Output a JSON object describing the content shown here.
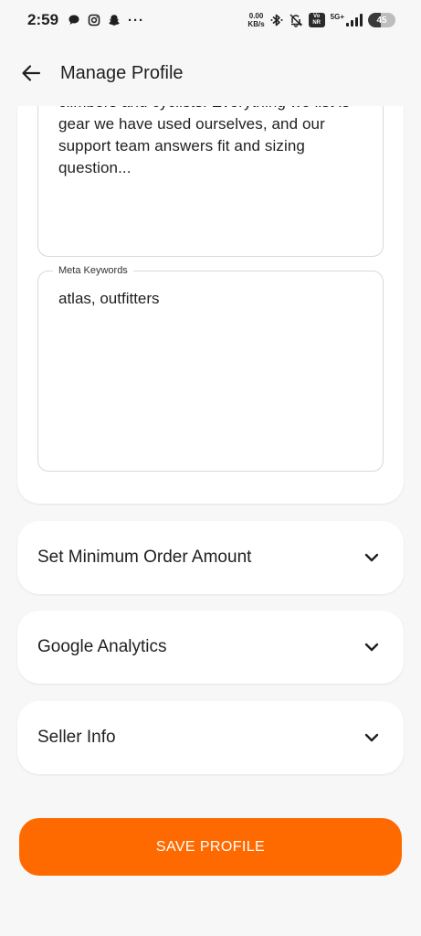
{
  "status_bar": {
    "time": "2:59",
    "net_speed_value": "0.00",
    "net_speed_unit": "KB/s",
    "volte_top": "Vo",
    "volte_bottom": "NR",
    "network_gen": "5G+",
    "battery_level": "45",
    "battery_fraction": 0.45,
    "icons": [
      "chat-icon",
      "instagram-icon",
      "snapchat-icon",
      "more-dots-icon",
      "bluetooth-icon",
      "mute-icon",
      "volte-icon",
      "signal-icon",
      "battery-icon"
    ]
  },
  "app_bar": {
    "title": "Manage Profile",
    "back_icon": "arrow-left-icon"
  },
  "seo_card": {
    "meta_description": "climbers and cyclists. Everything we list is gear we have used ourselves, and our support team answers fit and sizing question...",
    "meta_keywords_label": "Meta Keywords",
    "meta_keywords_value": "atlas, outfitters"
  },
  "sections": [
    {
      "label": "Set Minimum Order Amount",
      "icon": "chevron-down-icon"
    },
    {
      "label": "Google Analytics",
      "icon": "chevron-down-icon"
    },
    {
      "label": "Seller Info",
      "icon": "chevron-down-icon"
    }
  ],
  "save_button": {
    "label": "SAVE PROFILE"
  },
  "colors": {
    "accent": "#ff6a00",
    "background": "#f7f7f7",
    "card": "#ffffff",
    "border": "#d9d9d9",
    "text": "#1f1f1f"
  }
}
